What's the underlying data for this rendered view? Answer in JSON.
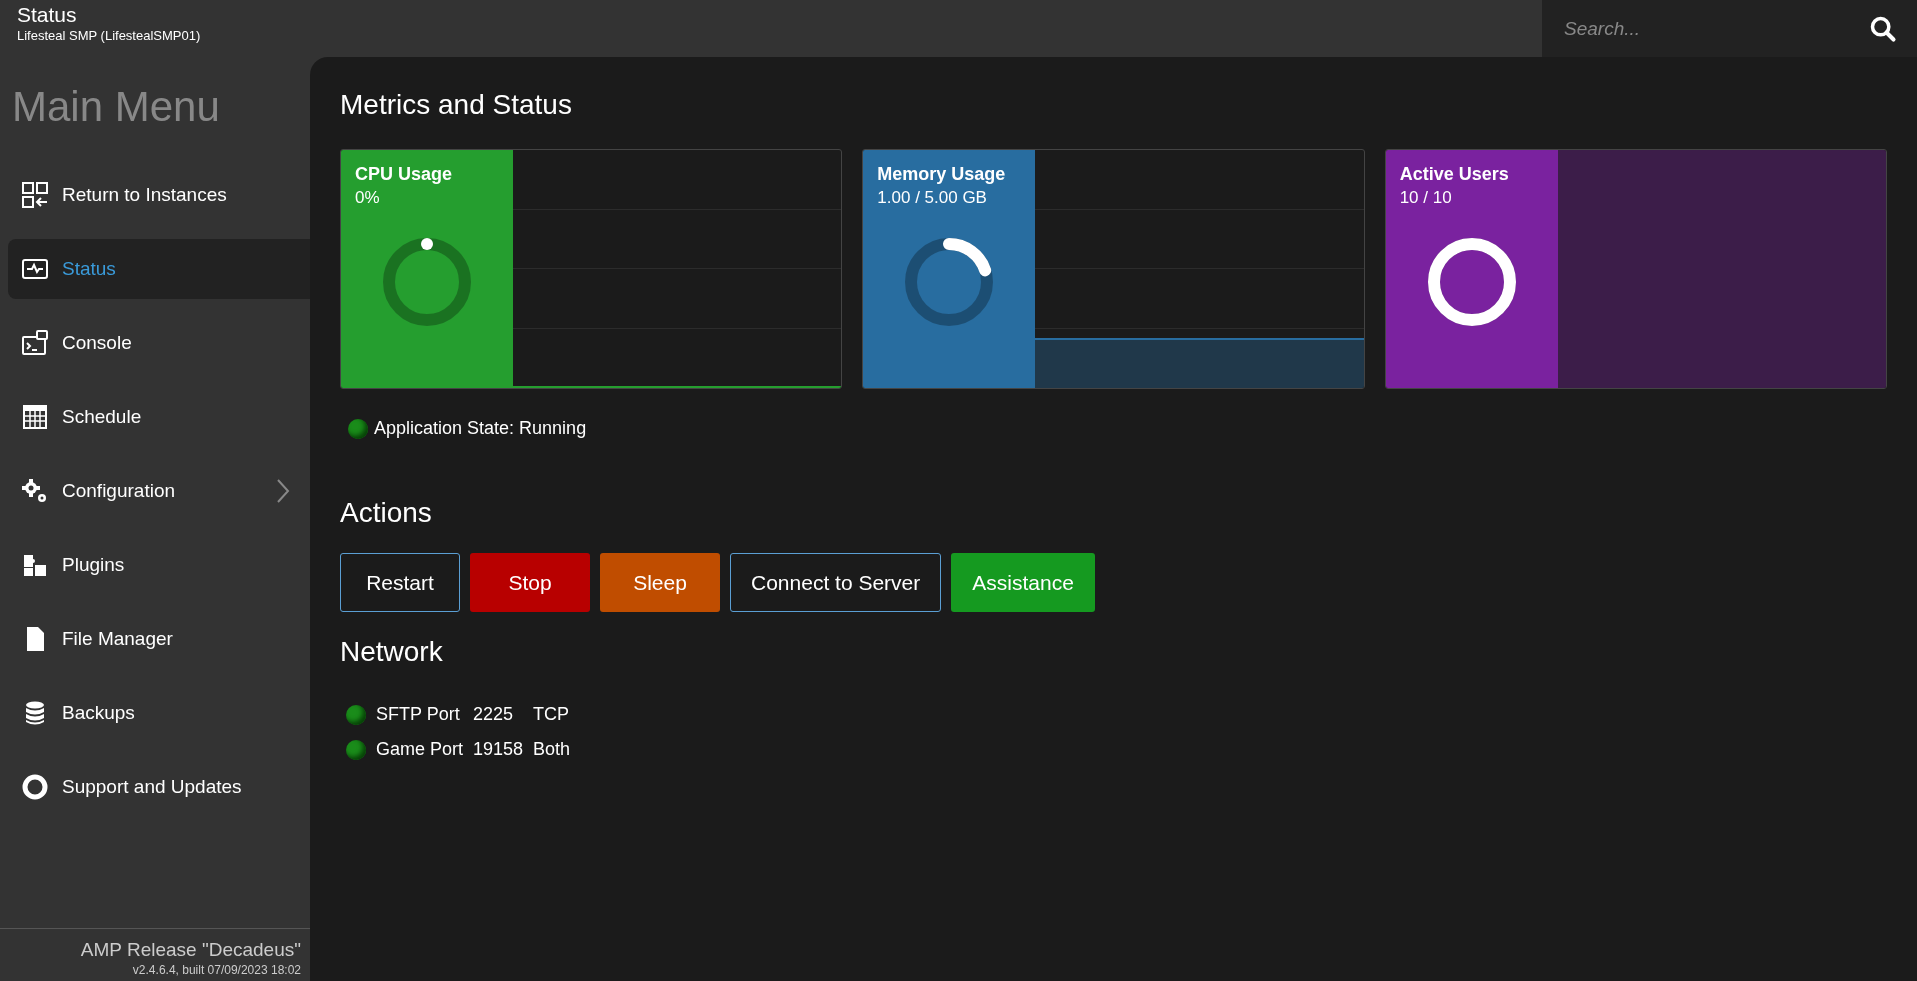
{
  "header": {
    "title": "Status",
    "subtitle": "Lifesteal SMP (LifestealSMP01)"
  },
  "search": {
    "placeholder": "Search..."
  },
  "sidebar": {
    "title": "Main Menu",
    "items": [
      {
        "label": "Return to Instances",
        "selected": false,
        "has_submenu": false
      },
      {
        "label": "Status",
        "selected": true,
        "has_submenu": false
      },
      {
        "label": "Console",
        "selected": false,
        "has_submenu": false
      },
      {
        "label": "Schedule",
        "selected": false,
        "has_submenu": false
      },
      {
        "label": "Configuration",
        "selected": false,
        "has_submenu": true
      },
      {
        "label": "Plugins",
        "selected": false,
        "has_submenu": false
      },
      {
        "label": "File Manager",
        "selected": false,
        "has_submenu": false
      },
      {
        "label": "Backups",
        "selected": false,
        "has_submenu": false
      },
      {
        "label": "Support and Updates",
        "selected": false,
        "has_submenu": false
      }
    ],
    "footer": {
      "release": "AMP Release \"Decadeus\"",
      "version": "v2.4.6.4, built 07/09/2023 18:02"
    }
  },
  "metrics": {
    "title": "Metrics and Status",
    "cards": [
      {
        "title": "CPU Usage",
        "reading": "0%",
        "level": 0,
        "color": "#259e2f"
      },
      {
        "title": "Memory Usage",
        "reading": "1.00 / 5.00 GB",
        "level": 0.2,
        "color": "#286da0"
      },
      {
        "title": "Active Users",
        "reading": "10 / 10",
        "level": 1,
        "color": "#7a229f"
      }
    ],
    "app_state": {
      "text": "Application State: Running",
      "running": true
    }
  },
  "actions": {
    "title": "Actions",
    "buttons": [
      {
        "label": "Restart",
        "kind": "outline"
      },
      {
        "label": "Stop",
        "kind": "danger"
      },
      {
        "label": "Sleep",
        "kind": "warning"
      },
      {
        "label": "Connect to Server",
        "kind": "outline"
      },
      {
        "label": "Assistance",
        "kind": "success"
      }
    ]
  },
  "network": {
    "title": "Network",
    "ports": [
      {
        "name": "SFTP Port",
        "port": "2225",
        "protocol": "TCP",
        "open": true
      },
      {
        "name": "Game Port",
        "port": "19158",
        "protocol": "Both",
        "open": true
      }
    ]
  }
}
